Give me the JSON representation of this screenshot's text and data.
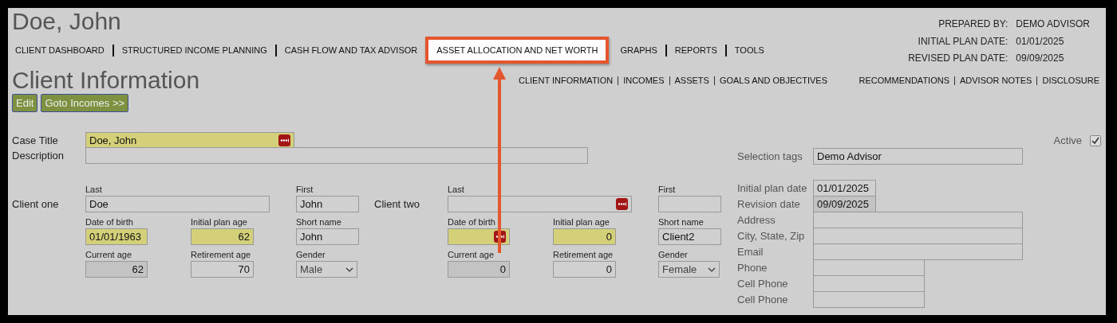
{
  "client_name": "Doe, John",
  "main_nav": [
    {
      "label": "CLIENT DASHBOARD",
      "highlighted": false
    },
    {
      "label": "STRUCTURED INCOME PLANNING",
      "highlighted": false
    },
    {
      "label": "CASH FLOW AND TAX ADVISOR",
      "highlighted": false
    },
    {
      "label": "ASSET ALLOCATION AND NET WORTH",
      "highlighted": true
    },
    {
      "label": "GRAPHS",
      "highlighted": false
    },
    {
      "label": "REPORTS",
      "highlighted": false
    },
    {
      "label": "TOOLS",
      "highlighted": false
    }
  ],
  "plan_info": [
    {
      "label": "PREPARED BY:",
      "value": "DEMO ADVISOR"
    },
    {
      "label": "INITIAL PLAN DATE:",
      "value": "01/01/2025"
    },
    {
      "label": "REVISED PLAN DATE:",
      "value": "09/09/2025"
    }
  ],
  "page_title": "Client Information",
  "sub_nav_left": [
    "CLIENT INFORMATION",
    "INCOMES",
    "ASSETS",
    "GOALS AND OBJECTIVES"
  ],
  "sub_nav_right": [
    "RECOMMENDATIONS",
    "ADVISOR NOTES",
    "DISCLOSURE"
  ],
  "buttons": [
    "Edit",
    "Goto Incomes >>"
  ],
  "case_title": {
    "label": "Case Title",
    "value": "Doe, John",
    "required": true,
    "disabled": false,
    "has_menu": true
  },
  "active": {
    "label": "Active",
    "checked": true
  },
  "description": {
    "label": "Description",
    "required": false,
    "disabled": false,
    "has_menu": false
  },
  "clients": [
    {
      "label": "Client one",
      "fields": [
        {
          "label": "Last",
          "value": "Doe",
          "kind": "text",
          "required": false,
          "disabled": false,
          "has_menu": false
        },
        {
          "label": "First",
          "value": "John",
          "kind": "text",
          "required": false,
          "disabled": false,
          "has_menu": false
        },
        {
          "label": "Date of birth",
          "value": "01/01/1963",
          "kind": "date",
          "required": true,
          "disabled": false,
          "has_menu": false
        },
        {
          "label": "Initial plan age",
          "value": "62",
          "kind": "number",
          "required": true,
          "disabled": false,
          "has_menu": false
        },
        {
          "label": "Short name",
          "value": "John",
          "kind": "text",
          "required": false,
          "disabled": false,
          "has_menu": false
        },
        {
          "label": "Current age",
          "value": "62",
          "kind": "number",
          "required": false,
          "disabled": true,
          "has_menu": false
        },
        {
          "label": "Retirement age",
          "value": "70",
          "kind": "number",
          "required": false,
          "disabled": false,
          "has_menu": false
        },
        {
          "label": "Gender",
          "value": "Male",
          "kind": "select",
          "required": false,
          "disabled": false,
          "has_menu": false
        }
      ]
    },
    {
      "label": "Client two",
      "fields": [
        {
          "label": "Last",
          "kind": "text",
          "required": false,
          "disabled": false,
          "has_menu": true
        },
        {
          "label": "First",
          "kind": "text",
          "required": false,
          "disabled": false,
          "has_menu": false
        },
        {
          "label": "Date of birth",
          "kind": "date",
          "required": true,
          "disabled": false,
          "has_menu": true
        },
        {
          "label": "Initial plan age",
          "value": "0",
          "kind": "number",
          "required": true,
          "disabled": false,
          "has_menu": false
        },
        {
          "label": "Short name",
          "value": "Client2",
          "kind": "text",
          "required": false,
          "disabled": false,
          "has_menu": false
        },
        {
          "label": "Current age",
          "value": "0",
          "kind": "number",
          "required": false,
          "disabled": true,
          "has_menu": false
        },
        {
          "label": "Retirement age",
          "value": "0",
          "kind": "number",
          "required": false,
          "disabled": false,
          "has_menu": false
        },
        {
          "label": "Gender",
          "value": "Female",
          "kind": "select",
          "required": false,
          "disabled": false,
          "has_menu": false
        }
      ]
    }
  ],
  "right_fields": [
    {
      "label": "Selection tags",
      "value": "Demo Advisor",
      "kind": "text",
      "disabled": false
    },
    {
      "label": "Initial plan date",
      "value": "01/01/2025",
      "kind": "date",
      "disabled": false
    },
    {
      "label": "Revision date",
      "value": "09/09/2025",
      "kind": "date",
      "disabled": true
    },
    {
      "label": "Address",
      "kind": "text",
      "disabled": false
    },
    {
      "label": "City, State, Zip",
      "kind": "text",
      "disabled": false
    },
    {
      "label": "Email",
      "kind": "text",
      "disabled": false
    },
    {
      "label": "Phone",
      "kind": "phone",
      "disabled": false
    },
    {
      "label": "Cell Phone",
      "kind": "phone",
      "disabled": false
    },
    {
      "label": "Cell Phone",
      "kind": "phone",
      "disabled": false
    }
  ],
  "annotation": {
    "arrow": true
  }
}
